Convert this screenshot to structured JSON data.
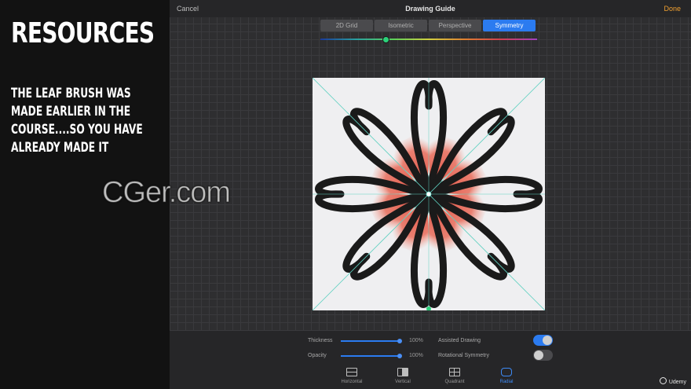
{
  "left_panel": {
    "title": "RESOURCES",
    "body": "THE LEAF BRUSH WAS MADE EARLIER IN THE COURSE....SO YOU HAVE ALREADY MADE IT"
  },
  "app": {
    "cancel_label": "Cancel",
    "title": "Drawing Guide",
    "done_label": "Done",
    "tabs": [
      {
        "label": "2D Grid",
        "active": false
      },
      {
        "label": "Isometric",
        "active": false
      },
      {
        "label": "Perspective",
        "active": false
      },
      {
        "label": "Symmetry",
        "active": true
      }
    ],
    "hue_value": 0.3,
    "settings": {
      "thickness_label": "Thickness",
      "thickness_value": "100%",
      "opacity_label": "Opacity",
      "opacity_value": "100%",
      "assisted_drawing_label": "Assisted Drawing",
      "assisted_drawing_on": true,
      "rotational_symmetry_label": "Rotational Symmetry",
      "rotational_symmetry_on": false
    },
    "options": [
      {
        "label": "Horizontal",
        "icon": "horizontal-symmetry-icon",
        "active": false
      },
      {
        "label": "Vertical",
        "icon": "vertical-symmetry-icon",
        "active": false
      },
      {
        "label": "Quadrant",
        "icon": "quadrant-symmetry-icon",
        "active": false
      },
      {
        "label": "Radial",
        "icon": "radial-symmetry-icon",
        "active": true
      }
    ]
  },
  "colors": {
    "accent": "#2b7bf0",
    "done": "#f0a030",
    "guide_line": "#5fd0c0",
    "leaf_dark": "#1a1a1a",
    "leaf_red": "#e04a3a"
  },
  "watermark": "CGer.com",
  "brand": "Udemy"
}
